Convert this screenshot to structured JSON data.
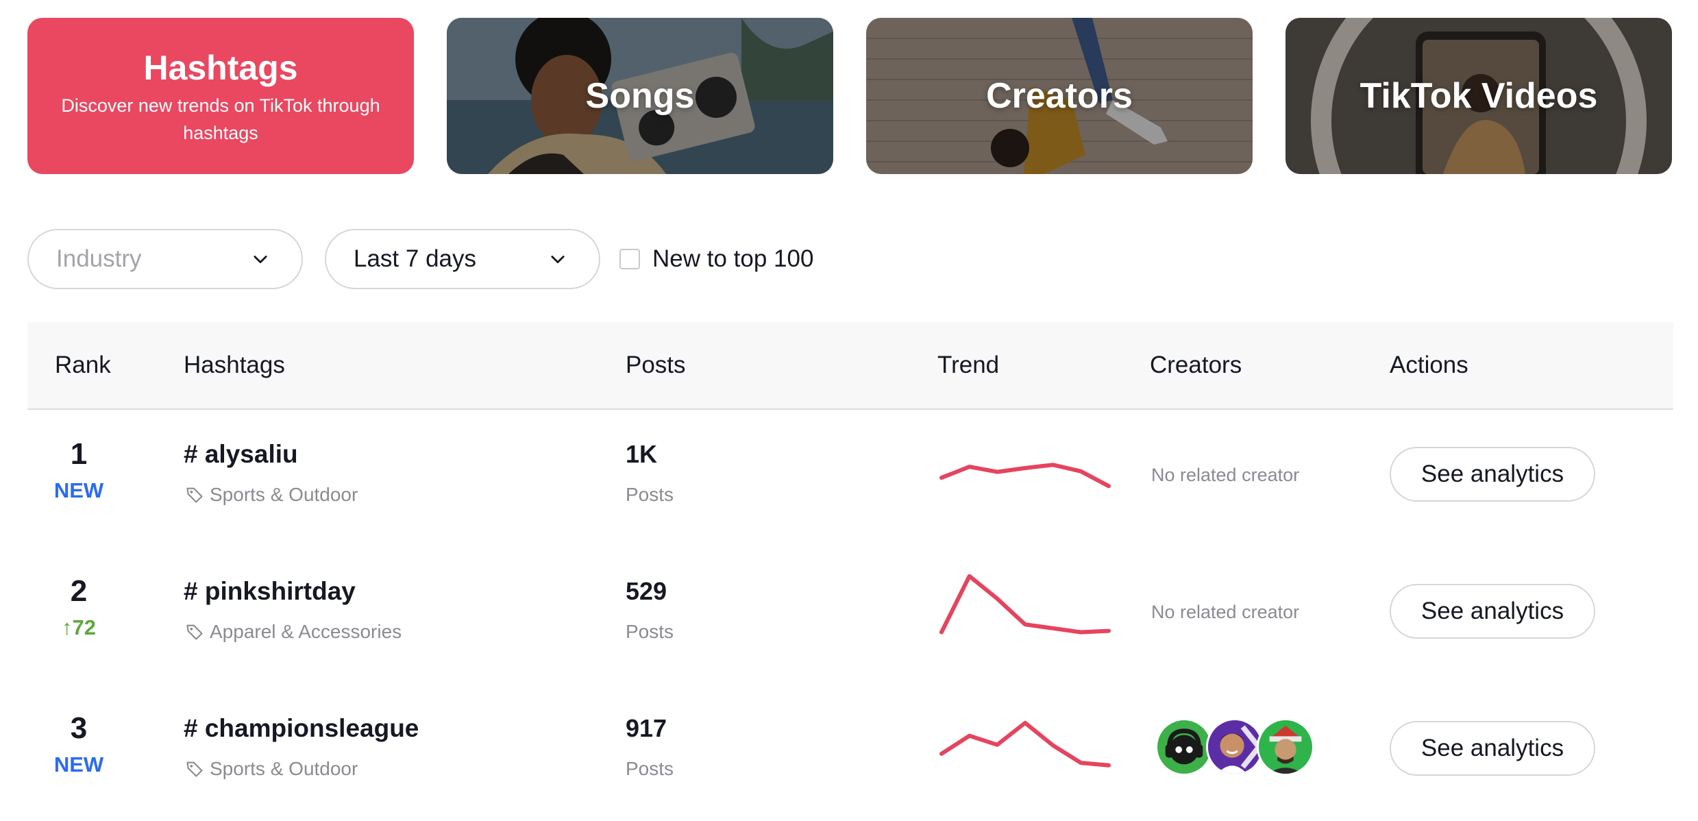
{
  "cards": [
    {
      "title": "Hashtags",
      "description": "Discover new trends on TikTok through hashtags",
      "active": true
    },
    {
      "title": "Songs",
      "active": false
    },
    {
      "title": "Creators",
      "active": false
    },
    {
      "title": "TikTok Videos",
      "active": false
    }
  ],
  "filters": {
    "industry": {
      "placeholder": "Industry",
      "icon": "chevron-down-icon"
    },
    "period": {
      "value": "Last 7 days",
      "icon": "chevron-down-icon"
    },
    "new_to_top": {
      "label": "New to top 100",
      "checked": false
    }
  },
  "table": {
    "headers": [
      "Rank",
      "Hashtags",
      "Posts",
      "Trend",
      "Creators",
      "Actions"
    ],
    "rows": [
      {
        "rank": "1",
        "badge": "NEW",
        "badge_type": "new",
        "hashtag": "# alysaliu",
        "industry": "Sports & Outdoor",
        "posts": "1K",
        "posts_label": "Posts",
        "trend": [
          0.35,
          0.52,
          0.44,
          0.5,
          0.55,
          0.45,
          0.22
        ],
        "creators_text": "No related creator",
        "creators": [],
        "action": "See analytics"
      },
      {
        "rank": "2",
        "badge": "↑72",
        "badge_type": "up",
        "hashtag": "# pinkshirtday",
        "industry": "Apparel & Accessories",
        "posts": "529",
        "posts_label": "Posts",
        "trend": [
          0.08,
          0.95,
          0.6,
          0.2,
          0.14,
          0.08,
          0.1
        ],
        "creators_text": "No related creator",
        "creators": [],
        "action": "See analytics"
      },
      {
        "rank": "3",
        "badge": "NEW",
        "badge_type": "new",
        "hashtag": "# championsleague",
        "industry": "Sports & Outdoor",
        "posts": "917",
        "posts_label": "Posts",
        "trend": [
          0.32,
          0.6,
          0.46,
          0.8,
          0.45,
          0.18,
          0.14
        ],
        "creators_text": "",
        "creators": [
          "creator-avatar-1",
          "creator-avatar-2",
          "creator-avatar-3"
        ],
        "action": "See analytics"
      }
    ]
  },
  "colors": {
    "accent": "#ea4760",
    "new_badge": "#2a6bf2",
    "up_badge": "#5da83b",
    "trend_line": "#e6445e"
  }
}
